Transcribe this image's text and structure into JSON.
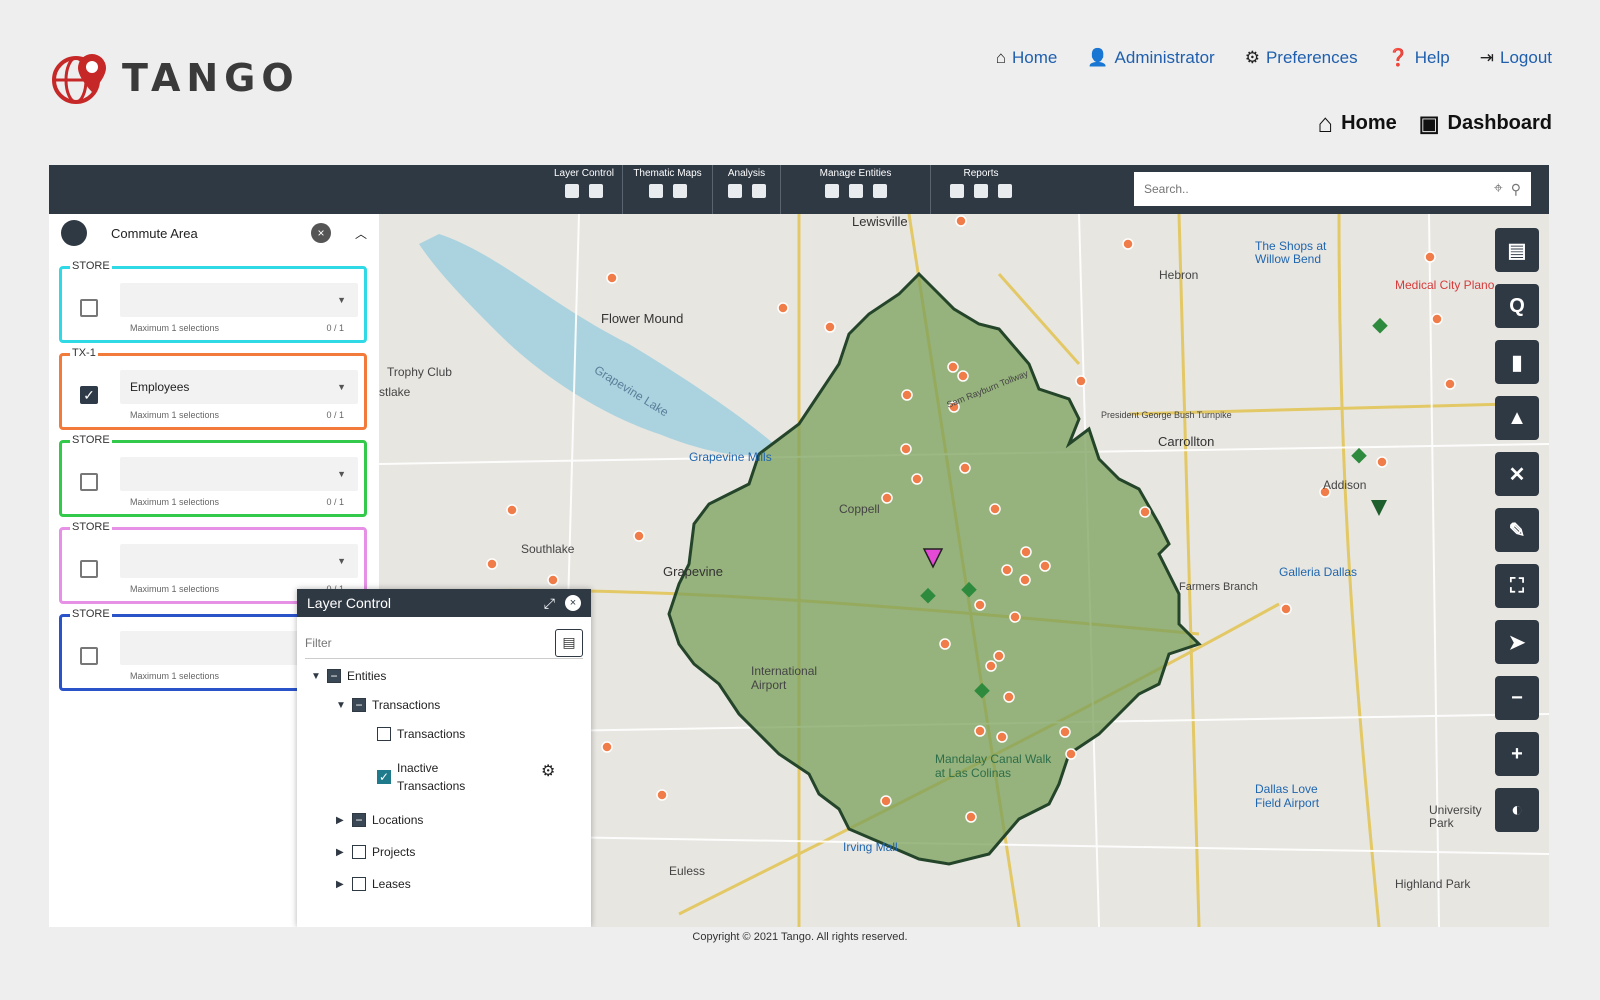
{
  "brand": {
    "name": "TANGO"
  },
  "topnav": [
    {
      "label": "Home",
      "icon": "home-icon"
    },
    {
      "label": "Administrator",
      "icon": "admin-icon"
    },
    {
      "label": "Preferences",
      "icon": "gears-icon"
    },
    {
      "label": "Help",
      "icon": "help-icon"
    },
    {
      "label": "Logout",
      "icon": "logout-icon"
    }
  ],
  "subnav": [
    {
      "label": "Home",
      "icon": "home-icon"
    },
    {
      "label": "Dashboard",
      "icon": "dashboard-icon"
    }
  ],
  "toolbar": {
    "groups": [
      "Layer Control",
      "Thematic Maps",
      "Analysis",
      "Manage Entities",
      "Reports"
    ],
    "search_placeholder": "Search.."
  },
  "sidebar": {
    "title": "Commute Area",
    "boxes": [
      {
        "caption": "STORE",
        "value": "",
        "checked": false,
        "hint": "Maximum 1 selections",
        "count": "0 / 1",
        "color": "#2fd9e6"
      },
      {
        "caption": "TX-1",
        "value": "Employees",
        "checked": true,
        "hint": "Maximum 1 selections",
        "count": "0 / 1",
        "color": "#f27a3a"
      },
      {
        "caption": "STORE",
        "value": "",
        "checked": false,
        "hint": "Maximum 1 selections",
        "count": "0 / 1",
        "color": "#33c94a"
      },
      {
        "caption": "STORE",
        "value": "",
        "checked": false,
        "hint": "Maximum 1 selections",
        "count": "0 / 1",
        "color": "#e690e6"
      },
      {
        "caption": "STORE",
        "value": "",
        "checked": false,
        "hint": "Maximum 1 selections",
        "count": "",
        "color": "#2a52c9"
      }
    ]
  },
  "layer_control": {
    "title": "Layer Control",
    "filter_placeholder": "Filter",
    "tree": [
      {
        "label": "Entities"
      },
      {
        "label": "Transactions"
      },
      {
        "label": "Transactions"
      },
      {
        "label": "Inactive Transactions"
      },
      {
        "label": "Locations"
      },
      {
        "label": "Projects"
      },
      {
        "label": "Leases"
      }
    ]
  },
  "map_labels": [
    "Lewisville",
    "Flower Mound",
    "Trophy Club",
    "stlake",
    "Grapevine Lake",
    "Grapevine Mills",
    "Southlake",
    "Grapevine",
    "Coppell",
    "Hebron",
    "Carrollton",
    "Addison",
    "The Shops at Willow Bend",
    "Medical City Plano",
    "Galleria Dallas",
    "International Airport",
    "Mandalay Canal Walk at Las Colinas",
    "Irving Mall",
    "Dallas Love Field Airport",
    "University Park",
    "Highland Park",
    "Euless",
    "Farmers Branch",
    "President George Bush Turnpike",
    "Sam Rayburn Tollway"
  ],
  "right_tools": [
    "clipboard-icon",
    "query-icon",
    "bookmark-icon",
    "shapes-icon",
    "tools-icon",
    "brush-icon",
    "fullscreen-icon",
    "navigate-icon",
    "zoom-out-icon",
    "zoom-in-icon",
    "contrast-icon"
  ],
  "footer": "Copyright © 2021 Tango. All rights reserved."
}
